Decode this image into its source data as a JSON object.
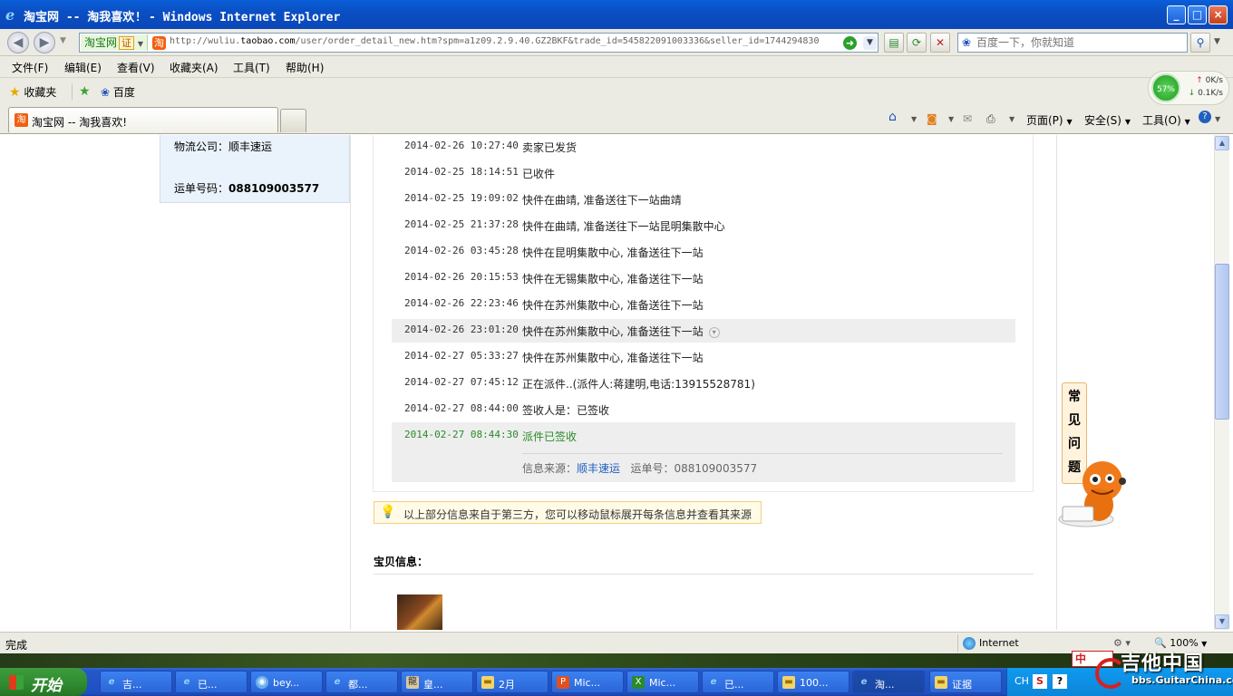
{
  "window": {
    "title": "淘宝网 -- 淘我喜欢! - Windows Internet Explorer",
    "min_label": "_",
    "max_label": "□",
    "close_label": "×"
  },
  "address": {
    "site_name": "淘宝网",
    "cert_label": "证",
    "url_prefix": "http://wuliu.",
    "url_domain": "taobao.com",
    "url_path": "/user/order_detail_new.htm?spm=a1z09.2.9.40.GZ2BKF&trade_id=545822091003336&seller_id=1744294830",
    "search_placeholder": "百度一下，你就知道"
  },
  "menu": [
    "文件(F)",
    "编辑(E)",
    "查看(V)",
    "收藏夹(A)",
    "工具(T)",
    "帮助(H)"
  ],
  "favorites": {
    "label": "收藏夹",
    "baidu": "百度"
  },
  "netspeed": {
    "percent": "57%",
    "up": "0K/s",
    "down": "0.1K/s"
  },
  "tab": {
    "title": "淘宝网 -- 淘我喜欢!"
  },
  "commands": {
    "page": "页面(P)",
    "safety": "安全(S)",
    "tools": "工具(O)"
  },
  "order": {
    "logistics_company_label": "物流公司：",
    "logistics_company": "顺丰速运",
    "tracking_no_label": "运单号码：",
    "tracking_no": "088109003577"
  },
  "tracking": [
    {
      "time": "2014-02-26 10:27:40",
      "msg": "卖家已发货"
    },
    {
      "time": "2014-02-25 18:14:51",
      "msg": "已收件"
    },
    {
      "time": "2014-02-25 19:09:02",
      "msg": "快件在曲靖, 准备送往下一站曲靖"
    },
    {
      "time": "2014-02-25 21:37:28",
      "msg": "快件在曲靖, 准备送往下一站昆明集散中心"
    },
    {
      "time": "2014-02-26 03:45:28",
      "msg": "快件在昆明集散中心, 准备送往下一站"
    },
    {
      "time": "2014-02-26 20:15:53",
      "msg": "快件在无锡集散中心, 准备送往下一站"
    },
    {
      "time": "2014-02-26 22:23:46",
      "msg": "快件在苏州集散中心, 准备送往下一站"
    },
    {
      "time": "2014-02-26 23:01:20",
      "msg": "快件在苏州集散中心, 准备送往下一站"
    },
    {
      "time": "2014-02-27 05:33:27",
      "msg": "快件在苏州集散中心, 准备送往下一站"
    },
    {
      "time": "2014-02-27 07:45:12",
      "msg": "正在派件..(派件人:蒋建明,电话:13915528781)"
    },
    {
      "time": "2014-02-27 08:44:00",
      "msg": "签收人是：已签收"
    },
    {
      "time": "2014-02-27 08:44:30",
      "msg": "派件已签收"
    }
  ],
  "source": {
    "label": "信息来源：",
    "company": "顺丰速运",
    "no_label": "运单号：",
    "no": "088109003577"
  },
  "notice": "以上部分信息来自于第三方，您可以移动鼠标展开每条信息并查看其来源",
  "item_info_heading": "宝贝信息：",
  "faq": [
    "常",
    "见",
    "问",
    "题"
  ],
  "status": {
    "text": "完成",
    "zone": "Internet",
    "zoom": "100%"
  },
  "taskbar": {
    "start": "开始",
    "tasks": [
      "吉...",
      "已...",
      "bey...",
      "都...",
      "皇...",
      "2月",
      "Mic...",
      "Mic...",
      "已...",
      "100...",
      "淘...",
      "证据"
    ],
    "lang": "CH"
  },
  "watermark": {
    "ime": "中",
    "logo": "吉他中国",
    "url": "bbs.GuitarChina.com"
  },
  "colors": {
    "title_bar": "#0a5fd8",
    "final_status": "#2a8a2a",
    "link": "#2060c0",
    "notice_bg": "#fffbe6",
    "taskbar": "#2458c8",
    "start_green": "#2f8a2f"
  }
}
